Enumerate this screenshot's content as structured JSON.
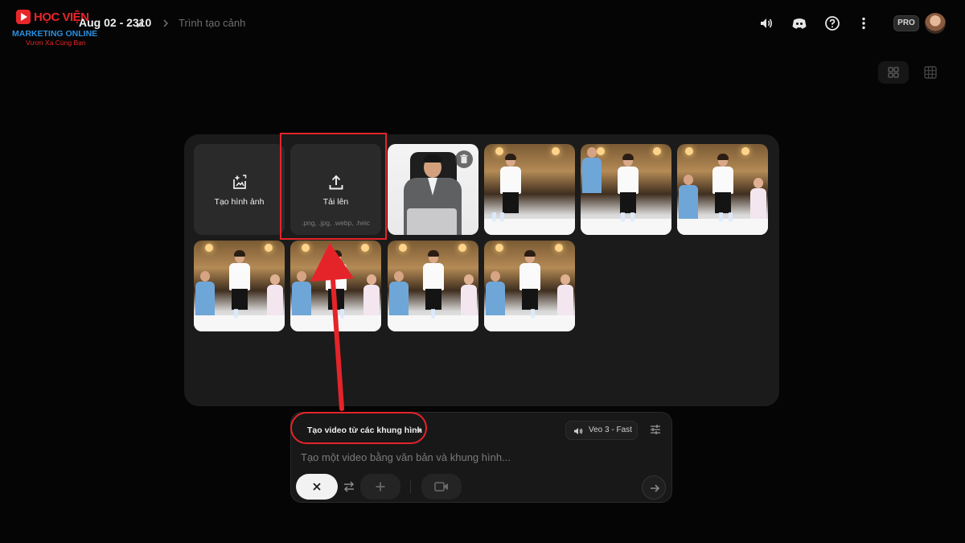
{
  "logo": {
    "line1": "HỌC VIỆN",
    "line2": "MARKETING ONLINE",
    "line3": "Vươn Xa Cùng Bạn"
  },
  "header": {
    "project_title": "Aug 02 - 2310",
    "breadcrumb": "Trình tạo cảnh",
    "badge": "PRO"
  },
  "toolbar_icons": [
    "volume-icon",
    "discord-icon",
    "help-icon",
    "more-icon"
  ],
  "view_toggle": [
    "grid-2x2-icon",
    "grid-3x3-icon"
  ],
  "media": {
    "create_image": {
      "label": "Tạo hình ảnh"
    },
    "upload": {
      "label": "Tải lên",
      "formats": ".png, .jpg, .webp, .heic"
    },
    "thumbnails_row1": 4,
    "thumbnails_row2": 4
  },
  "prompt": {
    "mode": "Tạo video từ các khung hình",
    "model": "Veo 3 - Fast",
    "placeholder": "Tạo một video bằng văn bản và khung hình..."
  },
  "colors": {
    "highlight": "#e5242a",
    "background": "#050505",
    "panel": "#1b1b1b"
  }
}
